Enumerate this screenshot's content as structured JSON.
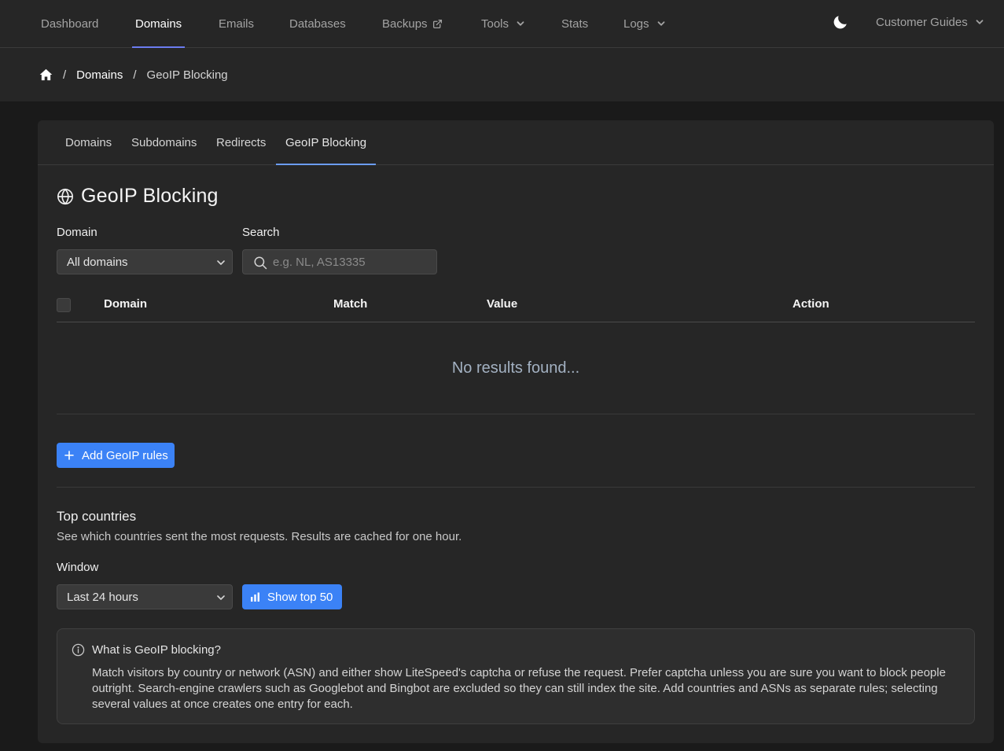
{
  "nav": {
    "items": [
      {
        "label": "Dashboard"
      },
      {
        "label": "Domains"
      },
      {
        "label": "Emails"
      },
      {
        "label": "Databases"
      },
      {
        "label": "Backups"
      },
      {
        "label": "Tools"
      },
      {
        "label": "Stats"
      },
      {
        "label": "Logs"
      }
    ],
    "active": "Domains",
    "guides_label": "Customer Guides",
    "theme_icon": "moon-icon"
  },
  "breadcrumb": {
    "home_icon": "home-icon",
    "link": "Domains",
    "current": "GeoIP Blocking",
    "separator": "/"
  },
  "tabs": [
    {
      "label": "Domains"
    },
    {
      "label": "Subdomains"
    },
    {
      "label": "Redirects"
    },
    {
      "label": "GeoIP Blocking"
    }
  ],
  "page": {
    "title": "GeoIP Blocking",
    "title_icon": "globe-icon"
  },
  "filters": {
    "domain_label": "Domain",
    "domain_value": "All domains",
    "search_label": "Search",
    "search_placeholder": "e.g. NL, AS13335"
  },
  "table": {
    "columns": [
      "Domain",
      "Match",
      "Value",
      "Action"
    ],
    "empty_text": "No results found..."
  },
  "actions": {
    "add_label": "Add GeoIP rules"
  },
  "top_countries": {
    "heading": "Top countries",
    "description": "See which countries sent the most requests. Results are cached for one hour.",
    "window_label": "Window",
    "window_value": "Last 24 hours",
    "show_label": "Show top 50"
  },
  "info": {
    "heading": "What is GeoIP blocking?",
    "body": "Match visitors by country or network (ASN) and either show LiteSpeed's captcha or refuse the request. Prefer captcha unless you are sure you want to block people outright. Search-engine crawlers such as Googlebot and Bingbot are excluded so they can still index the site. Add countries and ASNs as separate rules; selecting several values at once creates one entry for each."
  },
  "colors": {
    "accent": "#3b82f6",
    "nav_underline": "#6b7cf0",
    "background": "#1a1a1a",
    "panel": "#262626"
  }
}
